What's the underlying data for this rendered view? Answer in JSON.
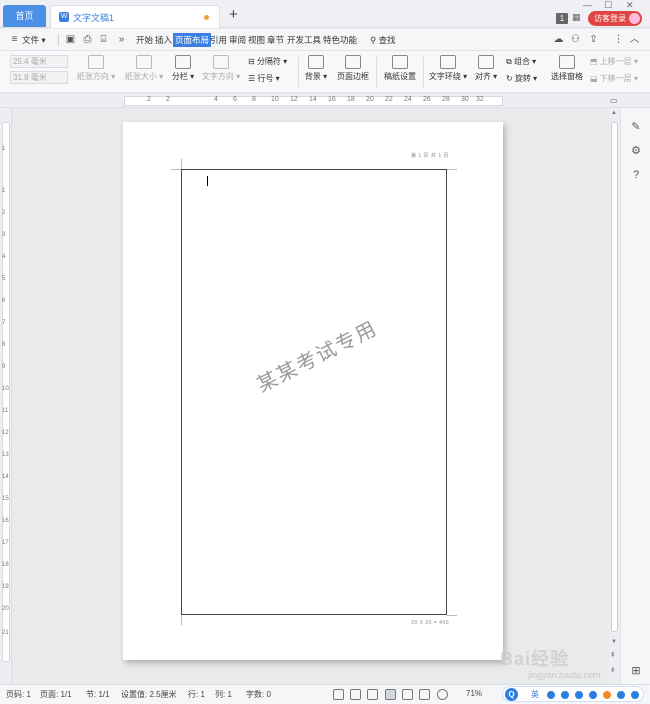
{
  "tabs": {
    "home": "首页",
    "document": "文字文稿1",
    "add": "+"
  },
  "title_right": {
    "badge": "1",
    "login": "访客登录"
  },
  "menu": {
    "file": "文件",
    "items": [
      "开始",
      "插入",
      "页面布局",
      "引用",
      "审阅",
      "视图",
      "章节",
      "开发工具",
      "特色功能"
    ],
    "active_index": 2,
    "search": "查找"
  },
  "ribbon": {
    "top_margin": "25.4 毫米",
    "bottom_margin": "31.8 毫米",
    "orientation": "纸张方向",
    "size": "纸张大小",
    "columns": "分栏",
    "text_direction": "文字方向",
    "breaks": "分隔符",
    "line_numbers": "行号",
    "background": "背景",
    "page_border": "页面边框",
    "draft_settings": "稿纸设置",
    "text_wrap": "文字环绕",
    "align": "对齐",
    "group": "组合",
    "rotate": "旋转",
    "selection_pane": "选择窗格",
    "bring_forward": "上移一层",
    "send_backward": "下移一层"
  },
  "ruler": {
    "h_ticks": [
      "2",
      "2",
      "4",
      "6",
      "8",
      "10",
      "12",
      "14",
      "16",
      "18",
      "20",
      "22",
      "24",
      "26",
      "28",
      "30",
      "32",
      "34",
      "36",
      "38"
    ],
    "v_ticks": [
      "1",
      "1",
      "2",
      "3",
      "4",
      "5",
      "6",
      "7",
      "8",
      "9",
      "10",
      "11",
      "12",
      "13",
      "14",
      "15",
      "16",
      "17",
      "18",
      "19",
      "20",
      "21"
    ]
  },
  "page": {
    "header": "第 1 页 共 1 页",
    "footer": "20 X 20 = 400",
    "watermark": "某某考试专用"
  },
  "status": {
    "page_num": "页码: 1",
    "pages": "页面: 1/1",
    "section": "节: 1/1",
    "setting": "设置值: 2.5厘米",
    "row": "行: 1",
    "col": "列: 1",
    "words": "字数: 0",
    "zoom": "71%",
    "ime_lang": "英"
  },
  "watermark_site": {
    "brand": "Bai经验",
    "url": "jingyan.baidu.com"
  },
  "colors": {
    "accent": "#3b7fe0",
    "login_red": "#e04444"
  }
}
